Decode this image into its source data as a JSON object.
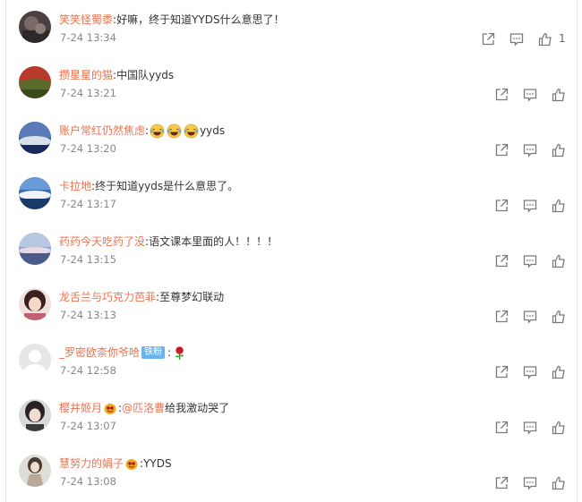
{
  "colors": {
    "username": "#eb7350",
    "text": "#333333",
    "time": "#888888",
    "icon": "#7a7a7a",
    "fan_badge": "#6bb3f0"
  },
  "comments": [
    {
      "username": "笑笑怪蜀黍",
      "text": "好嘛，终于知道YYDS什么意思了！",
      "time": "7-24 13:34",
      "like_count": "1",
      "avatar_icon": "avatar-photo"
    },
    {
      "username": "攒星星的猫",
      "text": "中国队yyds",
      "time": "7-24 13:21",
      "avatar_icon": "avatar-photo"
    },
    {
      "username": "账户常红仍然焦虑",
      "text": "yyds",
      "emoji_icon": "laughing-tears-emoji",
      "emoji_count": 3,
      "time": "7-24 13:20",
      "avatar_icon": "avatar-photo"
    },
    {
      "username": "卡拉地",
      "text": "终于知道yyds是什么意思了。",
      "time": "7-24 13:17",
      "avatar_icon": "avatar-photo"
    },
    {
      "username": "药药今天吃药了没",
      "text": "语文课本里面的人！！！！",
      "time": "7-24 13:15",
      "avatar_icon": "avatar-photo"
    },
    {
      "username": "龙舌兰与巧克力芭菲",
      "text": "至尊梦幻联动",
      "time": "7-24 13:13",
      "avatar_icon": "avatar-photo"
    },
    {
      "username": "_罗密欧柰你爷哈",
      "badge": "铁粉",
      "emoji_icon": "rose-emoji",
      "time": "7-24 12:58",
      "avatar_icon": "default-avatar"
    },
    {
      "username": "樱井姬月",
      "vip_icon": "vip-badge-icon",
      "mention": "@匹洛曹",
      "text": " 给我激动哭了",
      "time": "7-24 13:07",
      "avatar_icon": "avatar-photo"
    },
    {
      "username": "慧努力的娟子",
      "vip_icon": "vip-badge-icon",
      "text": "YYDS",
      "time": "7-24 13:08",
      "avatar_icon": "avatar-photo"
    }
  ]
}
